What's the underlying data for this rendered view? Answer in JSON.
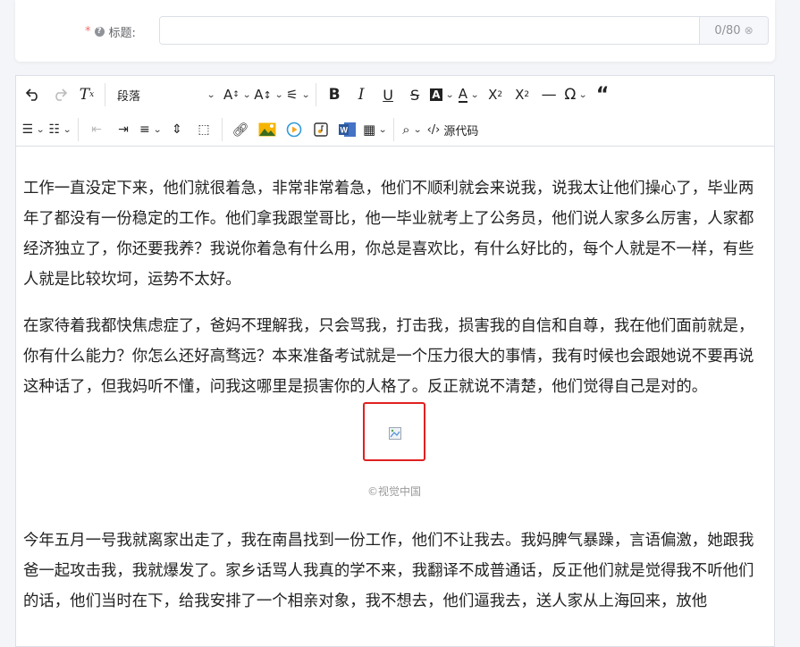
{
  "title_field": {
    "required_mark": "*",
    "label": "标题:",
    "value": "",
    "counter": "0/80"
  },
  "toolbar": {
    "paragraph_select": "段落",
    "source_code_label": "源代码"
  },
  "content": {
    "paragraphs": [
      "工作一直没定下来，他们就很着急，非常非常着急，他们不顺利就会来说我，说我太让他们操心了，毕业两年了都没有一份稳定的工作。他们拿我跟堂哥比，他一毕业就考上了公务员，他们说人家多么厉害，人家都经济独立了，你还要我养？我说你着急有什么用，你总是喜欢比，有什么好比的，每个人就是不一样，有些人就是比较坎坷，运势不太好。",
      "在家待着我都快焦虑症了，爸妈不理解我，只会骂我，打击我，损害我的自信和自尊，我在他们面前就是，你有什么能力？你怎么还好高骛远？本来准备考试就是一个压力很大的事情，我有时候也会跟她说不要再说这种话了，但我妈听不懂，问我这哪里是损害你的人格了。反正就说不清楚，他们觉得自己是对的。",
      "今年五月一号我就离家出走了，我在南昌找到一份工作，他们不让我去。我妈脾气暴躁，言语偏激，她跟我爸一起攻击我，我就爆发了。家乡话骂人我真的学不来，我翻译不成普通话，反正他们就是觉得我不听他们的话，他们当时在下，给我安排了一个相亲对象，我不想去，他们逼我去，送人家从上海回来，放他"
    ],
    "image_caption": "©视觉中国"
  }
}
